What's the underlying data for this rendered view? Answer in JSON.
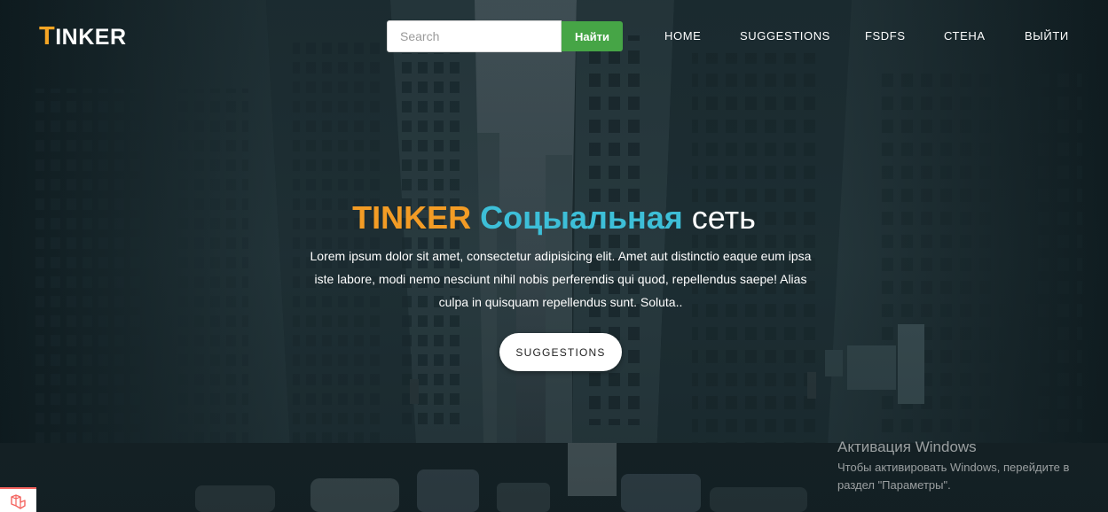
{
  "navbar": {
    "logo_first": "T",
    "logo_rest": "INKER",
    "search_placeholder": "Search",
    "search_button": "Найти",
    "links": [
      {
        "label": "HOME"
      },
      {
        "label": "SUGGESTIONS"
      },
      {
        "label": "FSDFS"
      },
      {
        "label": "СТЕНА"
      },
      {
        "label": "ВЫЙТИ"
      }
    ]
  },
  "hero": {
    "title_brand": "TINKER",
    "title_accent": "Соцыальная",
    "title_rest": "сеть",
    "text": "Lorem ipsum dolor sit amet, consectetur adipisicing elit. Amet aut distinctio eaque eum ipsa iste labore, modi nemo nesciunt nihil nobis perferendis qui quod, repellendus saepe! Alias culpa in quisquam repellendus sunt. Soluta..",
    "button": "SUGGESTIONS"
  },
  "watermark": {
    "title": "Активация Windows",
    "text": "Чтобы активировать Windows, перейдите в раздел \"Параметры\"."
  },
  "colors": {
    "brand_orange": "#f39c25",
    "accent_cyan": "#3dbfd8",
    "search_green": "#46a546",
    "debug_red": "#f4645f"
  },
  "icons": {
    "debug_tab": "laravel-logo-icon",
    "background": "city-street-photo"
  }
}
